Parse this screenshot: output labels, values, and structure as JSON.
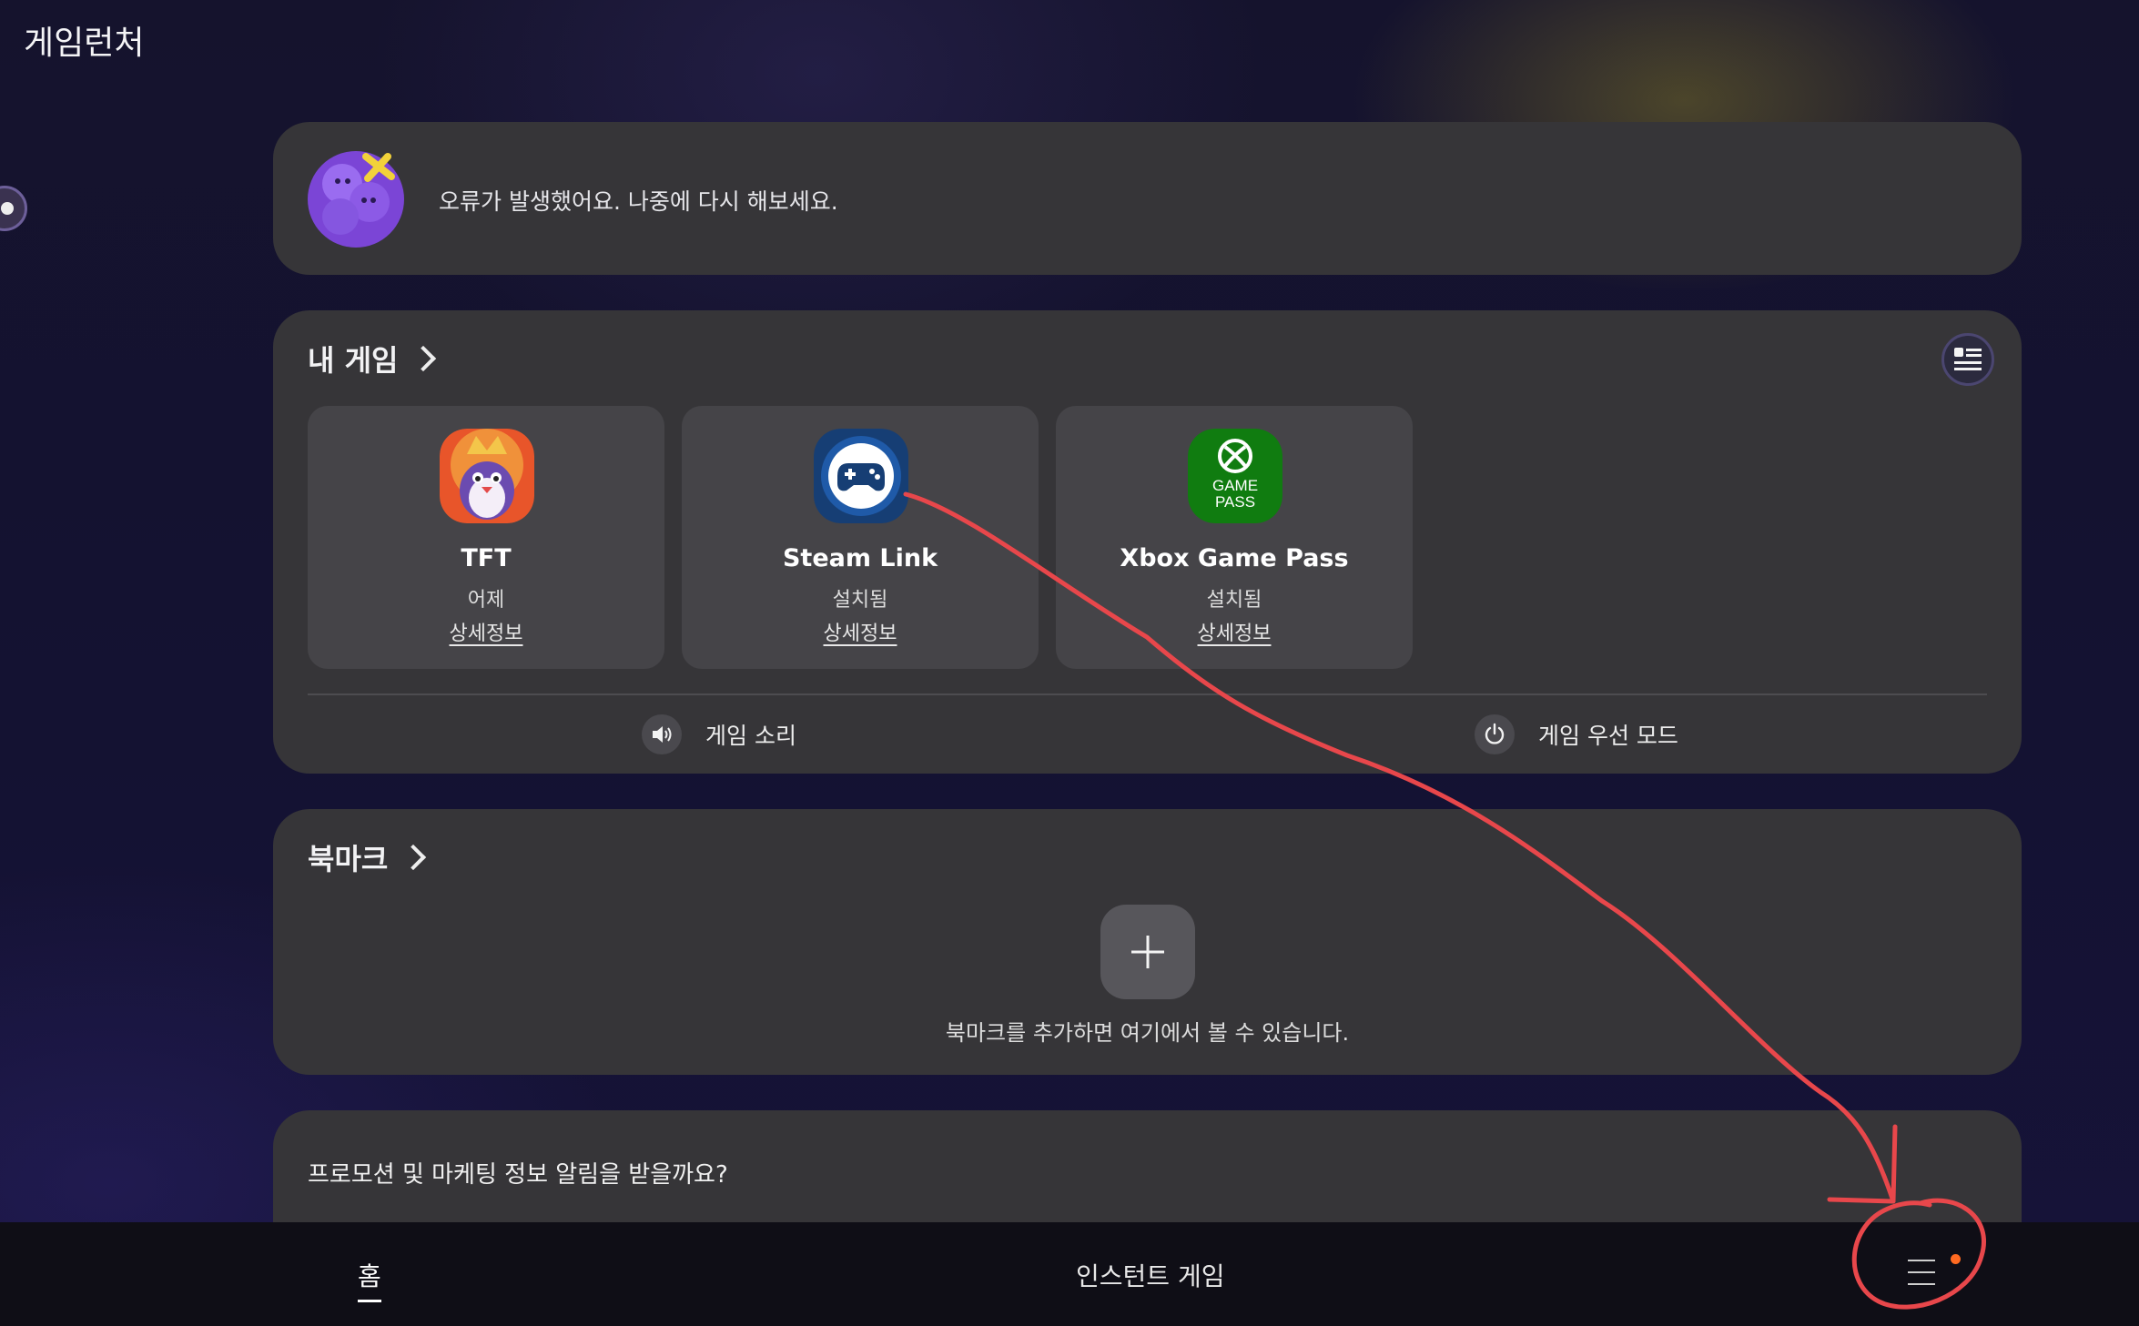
{
  "app": {
    "title": "게임런처"
  },
  "notice": {
    "message": "오류가 발생했어요. 나중에 다시 해보세요."
  },
  "my_games": {
    "title": "내 게임",
    "games": [
      {
        "name": "TFT",
        "status": "어제",
        "detail_link": "상세정보"
      },
      {
        "name": "Steam Link",
        "status": "설치됨",
        "detail_link": "상세정보"
      },
      {
        "name": "Xbox Game Pass",
        "status": "설치됨",
        "detail_link": "상세정보",
        "icon_text_line1": "GAME",
        "icon_text_line2": "PASS"
      }
    ],
    "quick_actions": {
      "game_sound": "게임 소리",
      "game_priority_mode": "게임 우선 모드"
    }
  },
  "bookmarks": {
    "title": "북마크",
    "empty_hint": "북마크를 추가하면 여기에서 볼 수 있습니다."
  },
  "promo": {
    "question": "프로모션 및 마케팅 정보 알림을 받을까요?"
  },
  "bottom_nav": {
    "home": "홈",
    "instant_games": "인스턴트 게임"
  },
  "colors": {
    "card_bg": "#363538",
    "tile_bg": "#454448",
    "xbox_green": "#107c10",
    "annotation_red": "#e8474b",
    "badge_dot": "#ff6a21"
  }
}
